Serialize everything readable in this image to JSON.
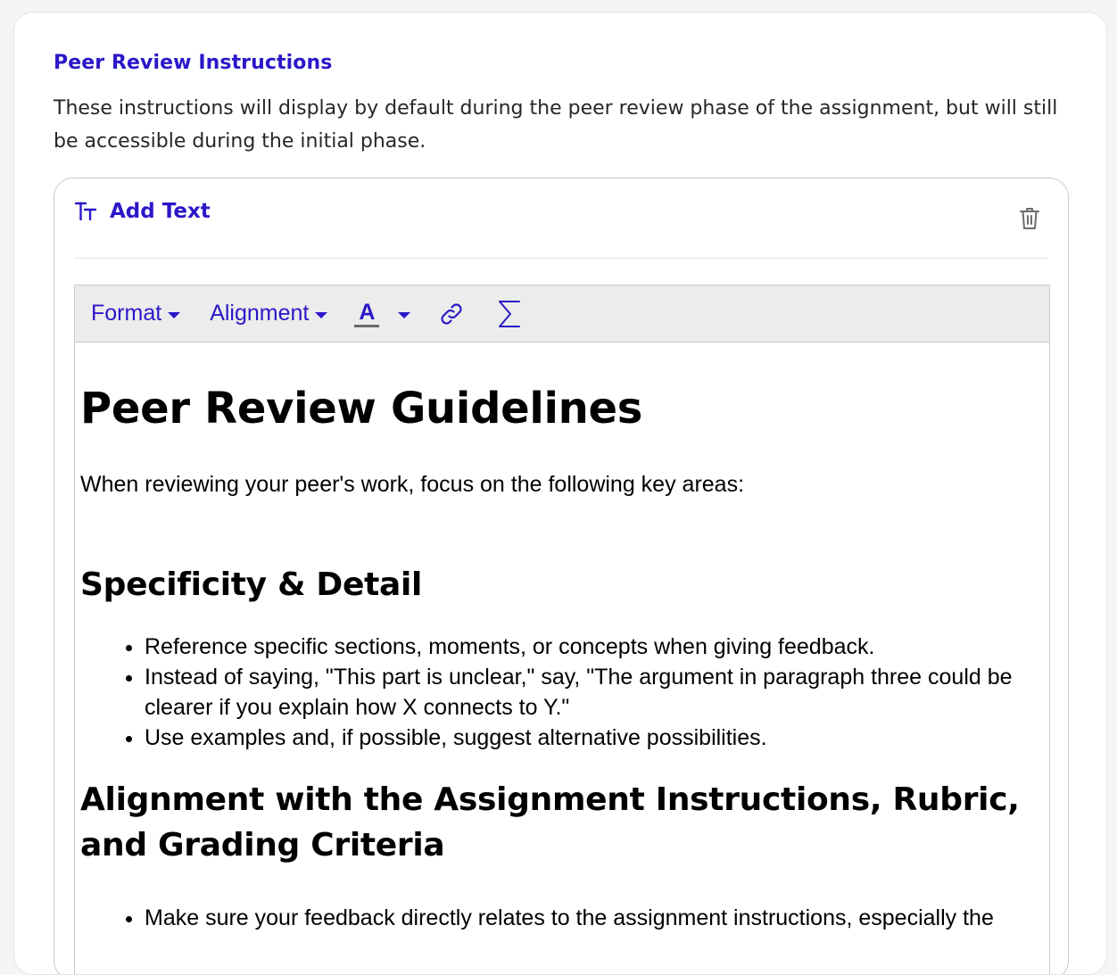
{
  "section": {
    "heading": "Peer Review Instructions",
    "description": "These instructions will display by default during the peer review phase of the assignment, but will still be accessible during the initial phase."
  },
  "block": {
    "add_text_label": "Add Text",
    "type_icon": "text-size-icon",
    "delete_icon": "trash-icon"
  },
  "toolbar": {
    "format_label": "Format",
    "alignment_label": "Alignment",
    "color_label": "A",
    "link_icon": "link-icon",
    "equation_icon": "sigma-icon"
  },
  "document": {
    "title": "Peer Review Guidelines",
    "intro": "When reviewing your peer's work, focus on the following key areas:",
    "sections": [
      {
        "heading": "Specificity & Detail",
        "items": [
          "Reference specific sections, moments, or concepts when giving feedback.",
          "Instead of saying, \"This part is unclear,\" say, \"The argument in paragraph three could be clearer if you explain how X connects to Y.\"",
          "Use examples and, if possible, suggest alternative possibilities."
        ]
      },
      {
        "heading": "Alignment with the Assignment Instructions, Rubric, and Grading Criteria",
        "items": [
          "Make sure your feedback directly relates to the assignment instructions, especially the"
        ]
      }
    ]
  },
  "colors": {
    "accent": "#2b17c9",
    "text": "#27272a",
    "toolbar_bg": "#ececec"
  }
}
